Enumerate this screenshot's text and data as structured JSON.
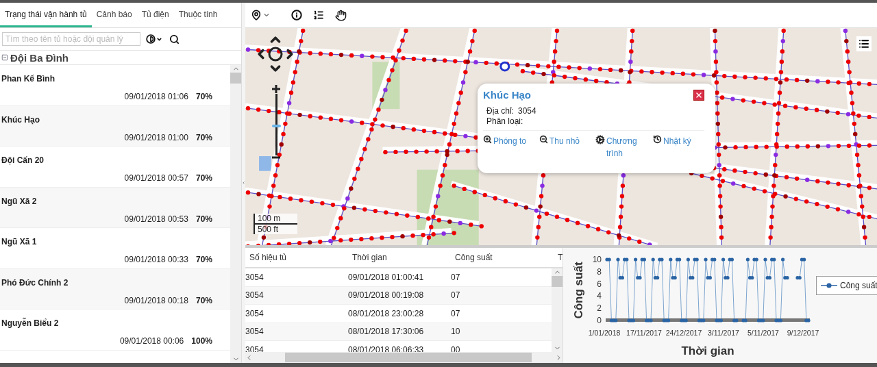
{
  "tabs": [
    {
      "label": "Trạng thái vận hành tủ",
      "selected": true
    },
    {
      "label": "Cảnh báo",
      "selected": false
    },
    {
      "label": "Tủ điện",
      "selected": false
    },
    {
      "label": "Thuộc tính",
      "selected": false
    }
  ],
  "search": {
    "placeholder": "Tìm theo tên tủ hoặc đội quản lý"
  },
  "group": {
    "label": "Đội Ba Đình",
    "expanded": true
  },
  "cabinets": [
    {
      "name": "Phan Kế Bình",
      "time": "09/01/2018 01:06",
      "power": "70%"
    },
    {
      "name": "Khúc Hạo",
      "time": "09/01/2018 01:00",
      "power": "70%"
    },
    {
      "name": "Đội Cấn 20",
      "time": "09/01/2018 00:57",
      "power": "70%"
    },
    {
      "name": "Ngũ Xã 2",
      "time": "09/01/2018 00:53",
      "power": "70%"
    },
    {
      "name": "Ngũ Xã 1",
      "time": "09/01/2018 00:33",
      "power": "70%"
    },
    {
      "name": "Phó Đức Chính 2",
      "time": "09/01/2018 00:18",
      "power": "70%"
    },
    {
      "name": "Nguyễn Biểu 2",
      "time": "09/01/2018 00:06",
      "power": "100%"
    }
  ],
  "map": {
    "zoom": {
      "level": 0.5
    },
    "scale": [
      "100 m",
      "500 ft"
    ],
    "popup": {
      "title": "Khúc Hạo",
      "fields": [
        {
          "label": "Địa chỉ:",
          "value": "3054"
        },
        {
          "label": "Phân loại:"
        }
      ],
      "actions": [
        {
          "kind": "zoom_in",
          "label": "Phóng to"
        },
        {
          "kind": "zoom_out",
          "label": "Thu nhỏ"
        },
        {
          "kind": "program",
          "label": "Chương trình"
        },
        {
          "kind": "log",
          "label": "Nhật ký"
        }
      ]
    }
  },
  "table": {
    "columns": [
      "Số hiệu tủ",
      "Thời gian",
      "Công suất",
      "T"
    ],
    "rows": [
      [
        "3054",
        "09/01/2018 01:00:41",
        "07"
      ],
      [
        "3054",
        "09/01/2018 00:19:08",
        "07"
      ],
      [
        "3054",
        "08/01/2018 23:00:28",
        "07"
      ],
      [
        "3054",
        "08/01/2018 17:30:06",
        "10"
      ],
      [
        "3054",
        "08/01/2018 06:06:33",
        "00"
      ]
    ]
  },
  "chart": {
    "ylabel": "Công suất",
    "xlabel": "Thời gian",
    "yticks": [
      "10",
      "8",
      "6",
      "4",
      "2",
      "0"
    ],
    "xticks": [
      "1/01/2018",
      "17/11/2017",
      "24/12/2017",
      "3/11/2017",
      "5/11/2017",
      "9/12/2017"
    ],
    "legend": "Công suất"
  }
}
